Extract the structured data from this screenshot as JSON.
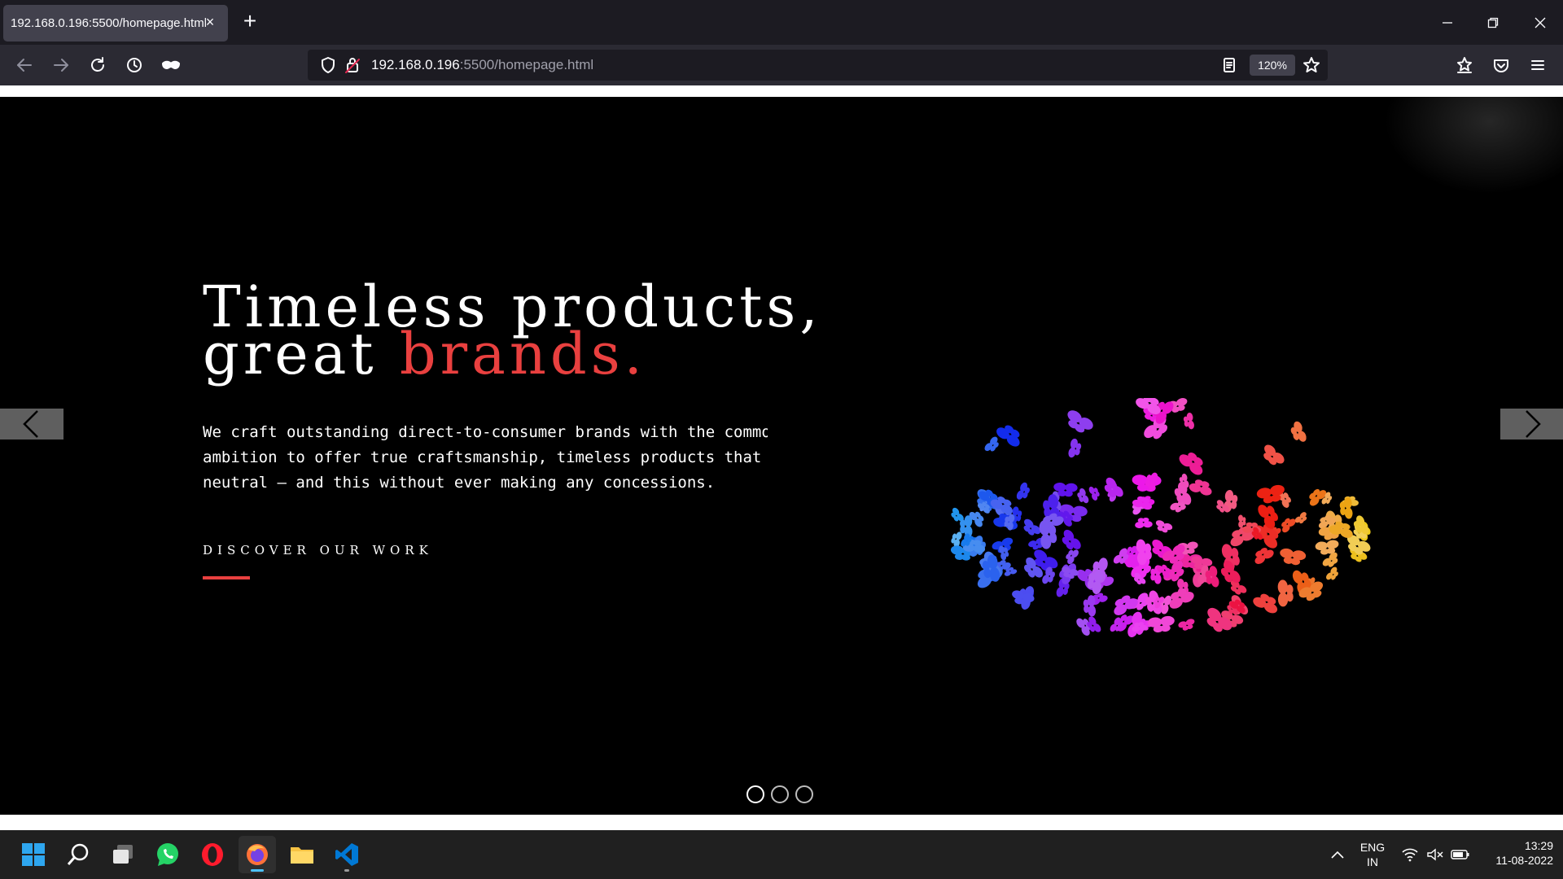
{
  "browser": {
    "tab_title": "192.168.0.196:5500/homepage.html",
    "tab_close": "×",
    "new_tab": "+",
    "url_host": "192.168.0.196",
    "url_rest": ":5500/homepage.html",
    "zoom": "120%"
  },
  "hero": {
    "headline_line1": "Timeless products,",
    "headline_line2_plain": "great ",
    "headline_line2_accent": "brands.",
    "description": "We craft outstanding direct-to-consumer brands with the common\nambition to offer true craftsmanship, timeless products that are\nneutral – and this without ever making any concessions.",
    "cta": "DISCOVER OUR WORK",
    "accent_color": "#e9403f",
    "carousel_slide_count": 3,
    "carousel_active_index": 0
  },
  "taskbar": {
    "apps": [
      "windows-start",
      "search",
      "task-view",
      "whatsapp",
      "opera",
      "firefox",
      "file-explorer",
      "vscode"
    ],
    "lang_line1": "ENG",
    "lang_line2": "IN",
    "time": "13:29",
    "date": "11-08-2022"
  }
}
